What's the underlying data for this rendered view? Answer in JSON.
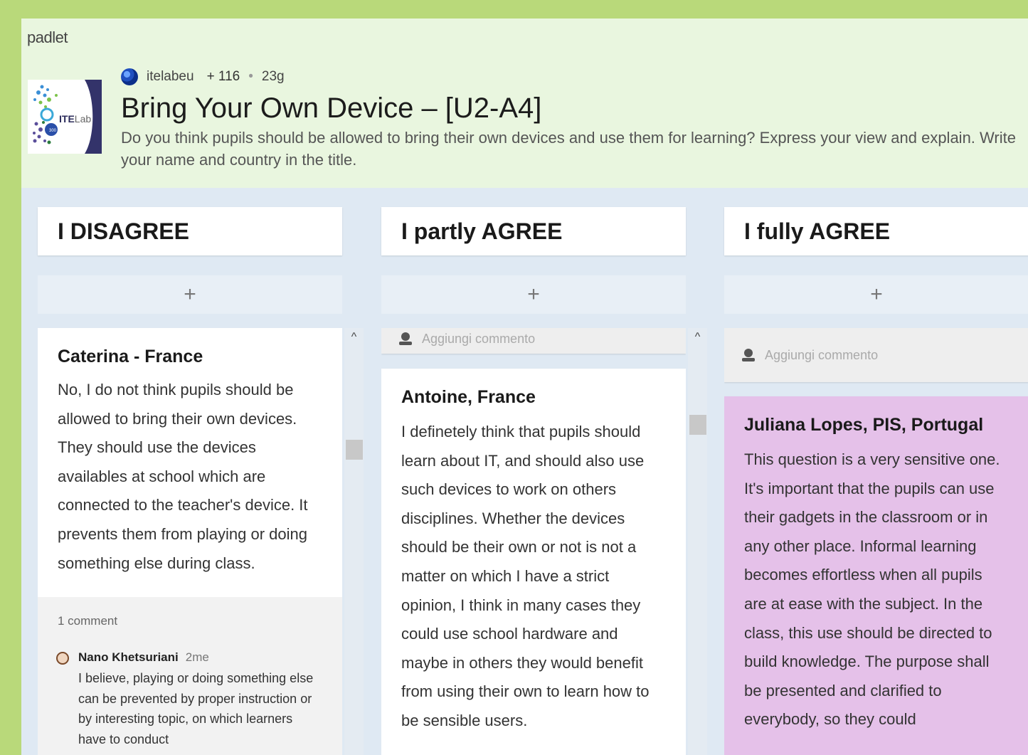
{
  "app": {
    "brand": "padlet"
  },
  "header": {
    "logo_text": "ITELab",
    "owner": "itelabeu",
    "likes": "+ 116",
    "age": "23g",
    "title": "Bring Your Own Device – [U2-A4]",
    "description": "Do you think pupils should be allowed to bring their own devices and use them for learning? Express your view and explain. Write your name and country in the title."
  },
  "columns": [
    {
      "title": "I DISAGREE",
      "add_label": "+",
      "posts": [
        {
          "title": "Caterina - France",
          "body": "No, I do not think pupils should be allowed to bring their own devices. They should use the devices availables at school which are connected to the teacher's device. It prevents them from playing or doing something else during class."
        }
      ],
      "comments": {
        "count_label": "1 comment",
        "items": [
          {
            "author": "Nano Khetsuriani",
            "time": "2me",
            "text": "I believe, playing or doing something else can be prevented by proper instruction or by interesting topic, on which learners have to conduct"
          }
        ]
      }
    },
    {
      "title": "I partly AGREE",
      "add_label": "+",
      "comment_placeholder": "Aggiungi commento",
      "posts": [
        {
          "title": "Antoine, France",
          "body": "I definetely think that pupils should learn about IT, and should also use such devices to work on others disciplines. Whether the devices should be their own or not is not a matter on which I have a strict opinion, I think in many cases they could use school hardware and maybe in others they would benefit from using their own to learn how to be sensible users."
        }
      ]
    },
    {
      "title": "I fully AGREE",
      "add_label": "+",
      "comment_placeholder": "Aggiungi commento",
      "posts": [
        {
          "title": "Juliana Lopes, PIS, Portugal",
          "body": "This question is a very sensitive one. It's important that the pupils can use their gadgets in the classroom or in any other place. Informal learning becomes effortless when all pupils are at ease with the subject. In the class, this use should be directed to build knowledge. The purpose shall be presented and clarified to everybody, so they could",
          "color": "#e5c1e9"
        }
      ]
    }
  ],
  "colors": {
    "background": "#b9d97a",
    "header": "#e9f6df",
    "board": "#dfe9f3"
  }
}
